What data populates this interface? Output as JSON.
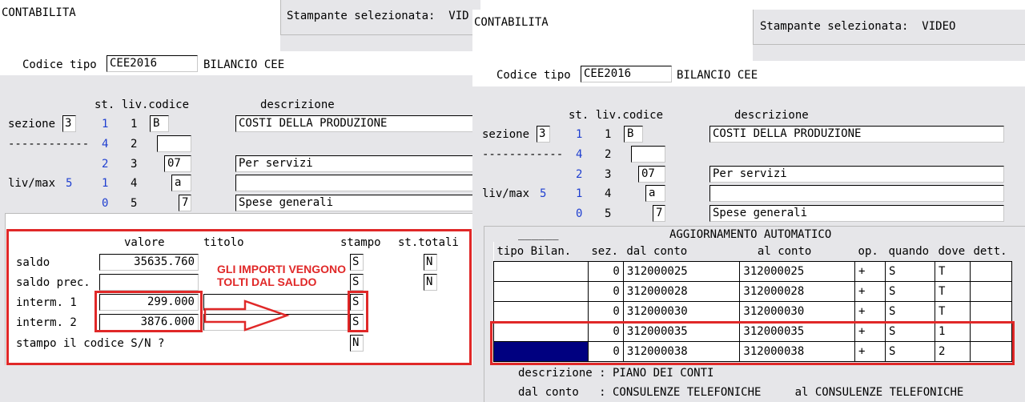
{
  "left": {
    "app_title": "CONTABILITA",
    "printer": "Stampante selezionata:  VID",
    "codice_tipo_label": "Codice tipo",
    "codice_tipo_value": "CEE2016",
    "codice_tipo_desc": "BILANCIO CEE",
    "col_st_liv": "st. liv.codice",
    "col_descrizione": "descrizione",
    "sezione_label": "sezione",
    "sezione_value": "3",
    "dashes": "------------",
    "livmax_label": "liv/max",
    "livmax_value": "5",
    "rows": [
      {
        "st": "1",
        "liv": "1",
        "codice": "B",
        "desc": "COSTI DELLA PRODUZIONE"
      },
      {
        "st": "4",
        "liv": "2",
        "codice": "",
        "desc": ""
      },
      {
        "st": "2",
        "liv": "3",
        "codice": "07",
        "desc": "Per servizi"
      },
      {
        "st": "1",
        "liv": "4",
        "codice": "a",
        "desc": ""
      },
      {
        "st": "0",
        "liv": "5",
        "codice": "7",
        "desc": "Spese generali"
      }
    ],
    "sub": {
      "col_valore": "valore",
      "col_titolo": "titolo",
      "col_stampo": "stampo",
      "col_sttotali": "st.totali",
      "saldo_label": "saldo",
      "saldo_value": "35635.760",
      "saldo_stampo": "S",
      "saldo_sttotali": "N",
      "saldo_prec_label": "saldo prec.",
      "saldo_prec_value": "",
      "saldo_prec_stampo": "S",
      "saldo_prec_sttotali": "N",
      "interm1_label": "interm. 1",
      "interm1_value": "299.000",
      "interm1_stampo": "S",
      "interm2_label": "interm. 2",
      "interm2_value": "3876.000",
      "interm2_stampo": "S",
      "stampo_codice_label": "stampo il codice S/N ?",
      "stampo_codice_value": "N"
    },
    "annotation": "GLI IMPORTI VENGONO\nTOLTI DAL SALDO"
  },
  "right": {
    "app_title": "CONTABILITA",
    "printer": "Stampante selezionata:  VIDEO",
    "codice_tipo_label": "Codice tipo",
    "codice_tipo_value": "CEE2016",
    "codice_tipo_desc": "BILANCIO CEE",
    "col_st_liv": "st. liv.codice",
    "col_descrizione": "descrizione",
    "sezione_label": "sezione",
    "sezione_value": "3",
    "dashes": "------------",
    "livmax_label": "liv/max",
    "livmax_value": "5",
    "rows": [
      {
        "st": "1",
        "liv": "1",
        "codice": "B",
        "desc": "COSTI DELLA PRODUZIONE"
      },
      {
        "st": "4",
        "liv": "2",
        "codice": "",
        "desc": ""
      },
      {
        "st": "2",
        "liv": "3",
        "codice": "07",
        "desc": "Per servizi"
      },
      {
        "st": "1",
        "liv": "4",
        "codice": "a",
        "desc": ""
      },
      {
        "st": "0",
        "liv": "5",
        "codice": "7",
        "desc": "Spese generali"
      }
    ],
    "agg": {
      "tab_label": "______",
      "title": "AGGIORNAMENTO AUTOMATICO",
      "headers": [
        "tipo Bilan.",
        "sez.",
        "dal conto",
        "al conto",
        "op.",
        "quando",
        "dove",
        "dett."
      ],
      "rows": [
        {
          "tipo": "",
          "sez": "0",
          "dal": "312000025",
          "al": "312000025",
          "op": "+",
          "quando": "S",
          "dove": "T",
          "dett": ""
        },
        {
          "tipo": "",
          "sez": "0",
          "dal": "312000028",
          "al": "312000028",
          "op": "+",
          "quando": "S",
          "dove": "T",
          "dett": ""
        },
        {
          "tipo": "",
          "sez": "0",
          "dal": "312000030",
          "al": "312000030",
          "op": "+",
          "quando": "S",
          "dove": "T",
          "dett": ""
        },
        {
          "tipo": "",
          "sez": "0",
          "dal": "312000035",
          "al": "312000035",
          "op": "+",
          "quando": "S",
          "dove": "1",
          "dett": ""
        },
        {
          "tipo": "",
          "sez": "0",
          "dal": "312000038",
          "al": "312000038",
          "op": "+",
          "quando": "S",
          "dove": "2",
          "dett": ""
        }
      ],
      "descrizione_line": "descrizione : PIANO DEI CONTI",
      "dalconto_line": "dal conto   : CONSULENZE TELEFONICHE     al CONSULENZE TELEFONICHE"
    }
  },
  "colors": {
    "panel": "#e6e6e9",
    "accent_red": "#e02828",
    "blue_text": "#1f3fd0",
    "selection": "#000080"
  }
}
